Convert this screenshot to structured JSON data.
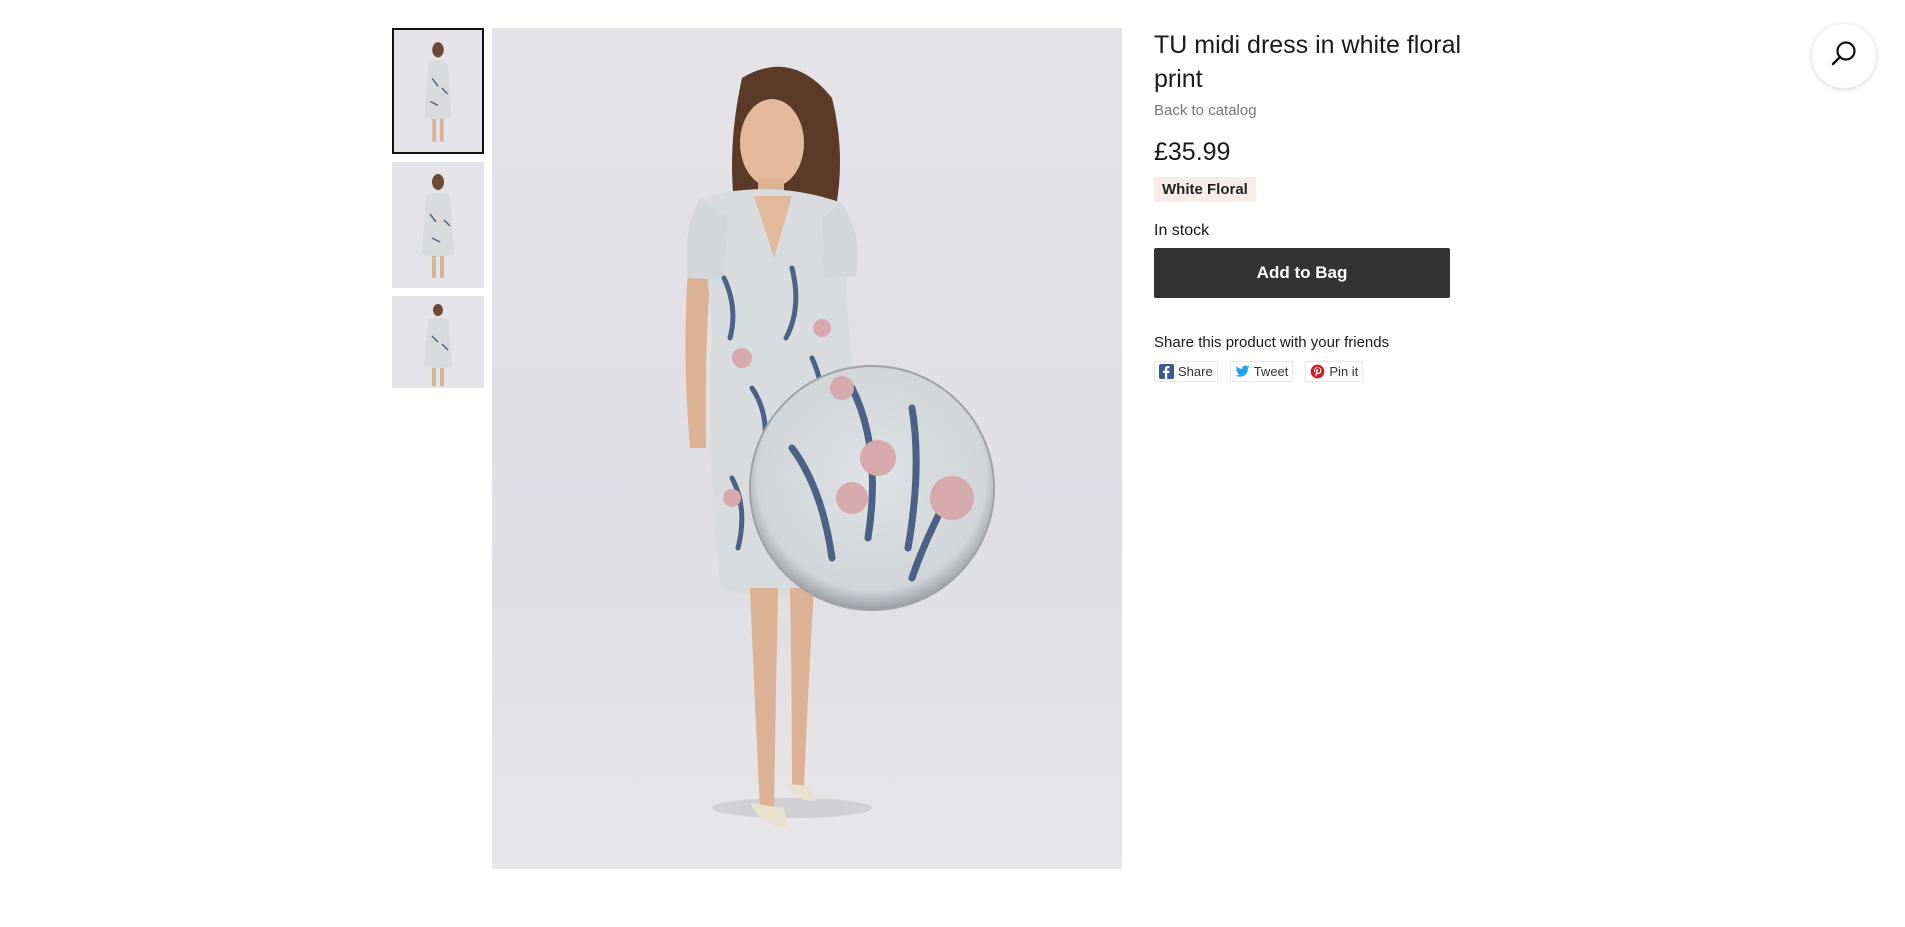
{
  "product": {
    "title": "TU midi dress in white floral print",
    "back_link": "Back to catalog",
    "price": "£35.99",
    "variant": "White Floral",
    "stock_status": "In stock",
    "add_to_bag_label": "Add to Bag"
  },
  "gallery": {
    "thumbnails": [
      {
        "name": "thumbnail-1",
        "active": true
      },
      {
        "name": "thumbnail-2",
        "active": false
      },
      {
        "name": "thumbnail-3",
        "active": false
      }
    ],
    "main_image_icon": "zoom-magnifier-lens"
  },
  "share": {
    "heading": "Share this product with your friends",
    "buttons": [
      {
        "label": "Share",
        "icon": "facebook-icon",
        "color": "#3b5998"
      },
      {
        "label": "Tweet",
        "icon": "twitter-icon",
        "color": "#1da1f2"
      },
      {
        "label": "Pin it",
        "icon": "pinterest-icon",
        "color": "#cb2027"
      }
    ]
  },
  "header": {
    "search_icon": "search-icon"
  },
  "colors": {
    "button_bg": "#333333",
    "variant_bg": "#f7ecea",
    "muted_text": "#777777"
  }
}
